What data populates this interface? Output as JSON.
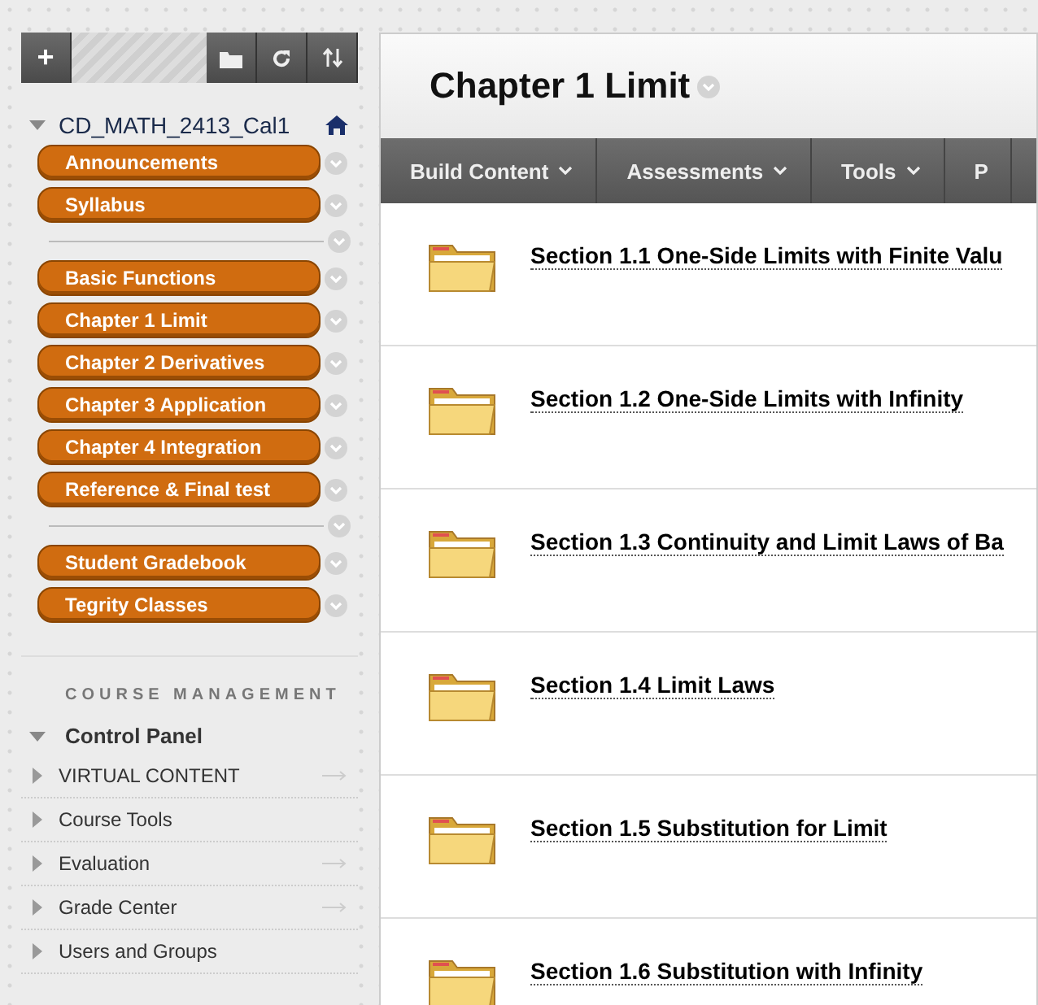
{
  "toolbar": {
    "add_label": "+"
  },
  "course": {
    "title": "CD_MATH_2413_Cal1",
    "expanded": true
  },
  "menu_groups": [
    {
      "items": [
        "Announcements",
        "Syllabus"
      ]
    },
    {
      "items": [
        "Basic Functions",
        "Chapter 1 Limit",
        "Chapter 2 Derivatives",
        "Chapter 3 Application",
        "Chapter 4 Integration",
        "Reference & Final test"
      ]
    },
    {
      "items": [
        "Student Gradebook",
        "Tegrity Classes"
      ]
    }
  ],
  "management": {
    "heading": "COURSE MANAGEMENT",
    "control_panel": {
      "label": "Control Panel",
      "expanded": true
    },
    "items": [
      {
        "label": "VIRTUAL CONTENT",
        "arrow": true
      },
      {
        "label": "Course Tools",
        "arrow": false
      },
      {
        "label": "Evaluation",
        "arrow": true
      },
      {
        "label": "Grade Center",
        "arrow": true
      },
      {
        "label": "Users and Groups",
        "arrow": false
      }
    ]
  },
  "page_title": "Chapter 1 Limit",
  "action_bar": [
    {
      "label": "Build Content",
      "dropdown": true
    },
    {
      "label": "Assessments",
      "dropdown": true
    },
    {
      "label": "Tools",
      "dropdown": true
    },
    {
      "label": "P",
      "dropdown": false
    }
  ],
  "sections": [
    "Section 1.1 One-Side Limits with Finite Valu",
    "Section 1.2 One-Side Limits with Infinity",
    "Section 1.3 Continuity and Limit Laws of Ba",
    "Section 1.4 Limit Laws",
    "Section 1.5 Substitution for Limit",
    "Section 1.6 Substitution with Infinity"
  ]
}
